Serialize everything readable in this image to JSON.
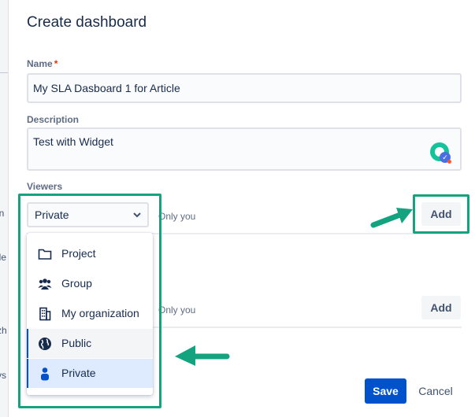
{
  "dialog": {
    "title": "Create dashboard"
  },
  "backdrop": {
    "fragments": [
      "in",
      "ile",
      "zh",
      "vs"
    ]
  },
  "name_field": {
    "label": "Name",
    "required_mark": "*",
    "value": "My SLA Dasboard 1 for Article"
  },
  "description_field": {
    "label": "Description",
    "value": "Test with Widget"
  },
  "viewers": {
    "label": "Viewers",
    "selected": "Private",
    "summary": "Only you",
    "add_label": "Add",
    "menu": [
      {
        "label": "Project",
        "icon": "folder-icon"
      },
      {
        "label": "Group",
        "icon": "group-icon"
      },
      {
        "label": "My organization",
        "icon": "building-icon"
      },
      {
        "label": "Public",
        "icon": "globe-icon"
      },
      {
        "label": "Private",
        "icon": "person-icon"
      }
    ]
  },
  "editors": {
    "summary": "Only you",
    "add_label": "Add"
  },
  "footer": {
    "save_label": "Save",
    "cancel_label": "Cancel"
  },
  "colors": {
    "accent": "#0052cc",
    "annotation": "#14a37f",
    "selected_bg": "#deebff"
  }
}
